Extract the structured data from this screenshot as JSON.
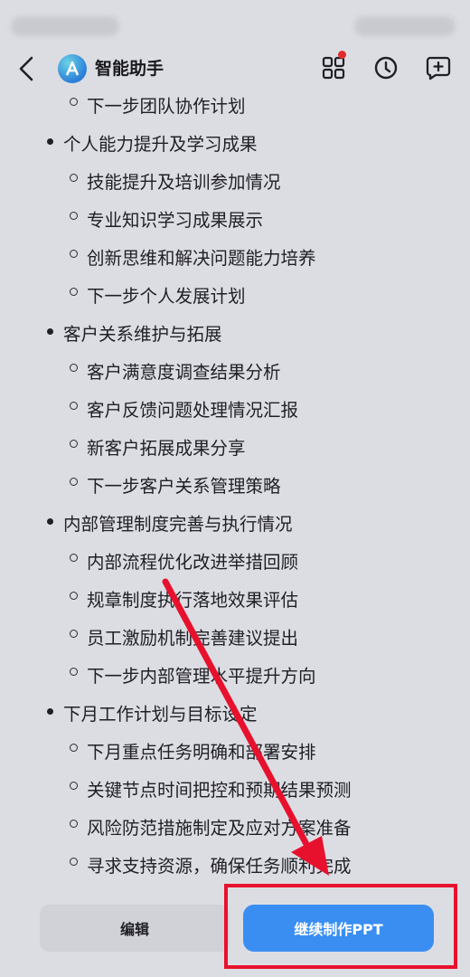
{
  "header": {
    "title": "智能助手",
    "icons": [
      "back-arrow-icon",
      "grid-apps-icon",
      "history-clock-icon",
      "new-chat-icon"
    ],
    "notification_color": "#e02b2b"
  },
  "outline": [
    {
      "level": 2,
      "text": "下一步团队协作计划"
    },
    {
      "level": 1,
      "text": "个人能力提升及学习成果"
    },
    {
      "level": 2,
      "text": "技能提升及培训参加情况"
    },
    {
      "level": 2,
      "text": "专业知识学习成果展示"
    },
    {
      "level": 2,
      "text": "创新思维和解决问题能力培养"
    },
    {
      "level": 2,
      "text": "下一步个人发展计划"
    },
    {
      "level": 1,
      "text": "客户关系维护与拓展"
    },
    {
      "level": 2,
      "text": "客户满意度调查结果分析"
    },
    {
      "level": 2,
      "text": "客户反馈问题处理情况汇报"
    },
    {
      "level": 2,
      "text": "新客户拓展成果分享"
    },
    {
      "level": 2,
      "text": "下一步客户关系管理策略"
    },
    {
      "level": 1,
      "text": "内部管理制度完善与执行情况"
    },
    {
      "level": 2,
      "text": "内部流程优化改进举措回顾"
    },
    {
      "level": 2,
      "text": "规章制度执行落地效果评估"
    },
    {
      "level": 2,
      "text": "员工激励机制完善建议提出"
    },
    {
      "level": 2,
      "text": "下一步内部管理水平提升方向"
    },
    {
      "level": 1,
      "text": "下月工作计划与目标设定"
    },
    {
      "level": 2,
      "text": "下月重点任务明确和部署安排"
    },
    {
      "level": 2,
      "text": "关键节点时间把控和预期结果预测"
    },
    {
      "level": 2,
      "text": "风险防范措施制定及应对方案准备"
    },
    {
      "level": 2,
      "text": "寻求支持资源，确保任务顺利完成"
    }
  ],
  "footer": {
    "edit_label": "编辑",
    "continue_label": "继续制作PPT"
  },
  "colors": {
    "accent": "#3a8ef2",
    "annotation": "#e8112d",
    "background": "#dcdde3"
  }
}
